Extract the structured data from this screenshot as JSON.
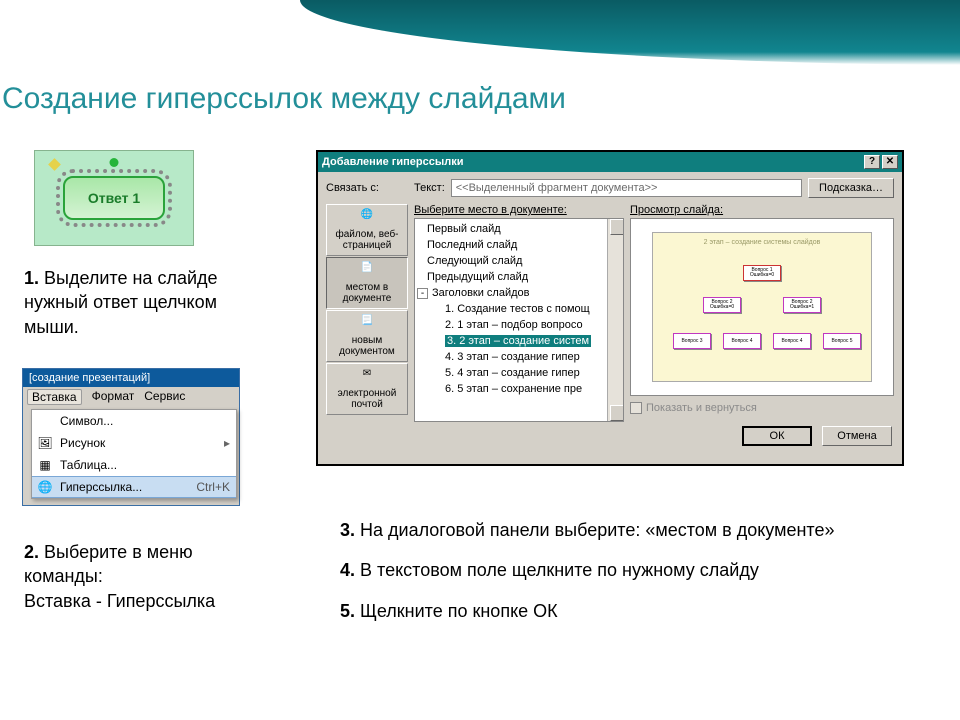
{
  "title": "Создание гиперссылок между слайдами",
  "shape": {
    "label": "Ответ 1"
  },
  "step1": {
    "num": "1.",
    "text": " Выделите на слайде нужный ответ щелчком мыши."
  },
  "menu": {
    "title": "[создание презентаций]",
    "bar": {
      "item1": "Вставка",
      "item2": "Формат",
      "item3": "Сервис"
    },
    "items": [
      {
        "label": "Символ...",
        "hasSub": false
      },
      {
        "label": "Рисунок",
        "hasSub": true
      },
      {
        "label": "Таблица...",
        "hasSub": false
      },
      {
        "label": "Гиперссылка...",
        "shortcut": "Ctrl+K",
        "selected": true
      }
    ]
  },
  "step2": {
    "num": "2.",
    "text": " Выберите в меню команды:",
    "text2": "Вставка - Гиперссылка"
  },
  "dialog": {
    "title": "Добавление гиперссылки",
    "link_with": "Связать с:",
    "text_label": "Текст:",
    "text_value": "<<Выделенный фрагмент документа>>",
    "hint_btn": "Подсказка…",
    "side": [
      {
        "label": "файлом, веб-страницей"
      },
      {
        "label": "местом в документе",
        "selected": true
      },
      {
        "label": "новым документом"
      },
      {
        "label": "электронной почтой"
      }
    ],
    "mid_label": "Выберите место в документе:",
    "tree": {
      "top": [
        "Первый слайд",
        "Последний слайд",
        "Следующий слайд",
        "Предыдущий слайд"
      ],
      "group": "Заголовки слайдов",
      "children": [
        "1. Создание тестов с помощ",
        "2. 1 этап – подбор вопросо",
        "3. 2 этап – создание систем",
        "4. 3 этап – создание гипер",
        "5. 4 этап – создание гипер",
        "6. 5 этап – сохранение пре"
      ],
      "selected_index": 2
    },
    "right_label": "Просмотр слайда:",
    "preview_title": "2 этап – создание системы слайдов",
    "nodes": {
      "q1": "Вопрос 1",
      "e0": "Ошибка=0",
      "q2": "Вопрос 2",
      "e1": "Ошибка=1",
      "v3": "Вопрос 3",
      "v4": "Вопрос 4",
      "v5": "Вопрос 5"
    },
    "show_return": "Показать и вернуться",
    "ok": "ОК",
    "cancel": "Отмена"
  },
  "step3": {
    "num": "3.",
    "text": " На диалоговой панели выберите: «местом в документе»"
  },
  "step4": {
    "num": "4.",
    "text": " В текстовом поле щелкните по нужному слайду"
  },
  "step5": {
    "num": "5.",
    "text": " Щелкните по кнопке ОК"
  }
}
